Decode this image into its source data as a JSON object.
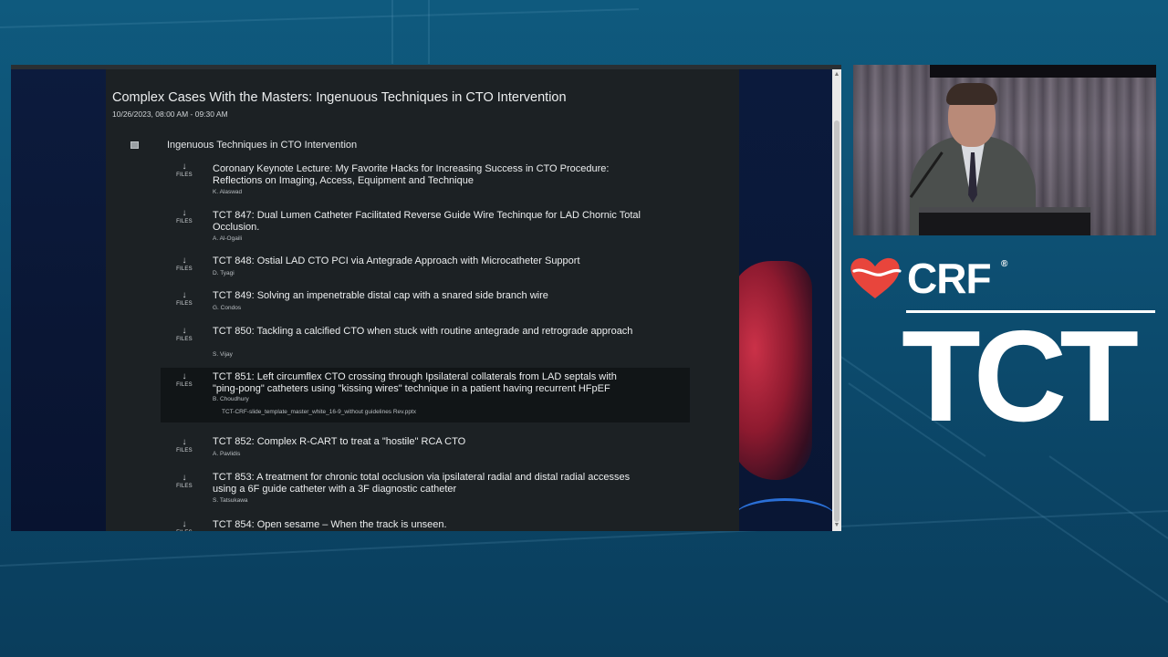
{
  "session": {
    "title": "Complex Cases With the Masters: Ingenuous Techniques in CTO Intervention",
    "datetime": "10/26/2023, 08:00 AM - 09:30 AM",
    "group_title": "Ingenuous Techniques in CTO Intervention"
  },
  "files_label": "FILES",
  "download_glyph": "↓",
  "items": [
    {
      "title": "Coronary Keynote Lecture: My Favorite Hacks for Increasing Success in CTO Procedure: Reflections on Imaging, Access, Equipment and Technique",
      "author": "K. Alaswad"
    },
    {
      "title": "TCT 847: Dual Lumen Catheter Facilitated Reverse Guide Wire Techinque for LAD Chornic Total Occlusion.",
      "author": "A. Al-Ogaili"
    },
    {
      "title": "TCT 848: Ostial LAD CTO PCI via Antegrade Approach with Microcatheter Support",
      "author": "D. Tyagi"
    },
    {
      "title": "TCT 849: Solving an impenetrable distal cap with a snared side branch wire",
      "author": "G. Condos"
    },
    {
      "title": "TCT 850: Tackling a calcified CTO when stuck with routine antegrade and retrograde approach",
      "author": "S. Vijay"
    },
    {
      "title": "TCT 851: Left circumflex CTO crossing through Ipsilateral collaterals from LAD septals with \"ping-pong\" catheters using \"kissing wires\" technique in a patient having recurrent HFpEF",
      "author": "B. Choudhury",
      "attachment": "TCT-CRF-slide_template_master_white_16-9_without guidelines Rev.pptx"
    },
    {
      "title": "TCT 852: Complex R-CART to treat a \"hostile\" RCA CTO",
      "author": "A. Pavlidis"
    },
    {
      "title": "TCT 853: A treatment for chronic total occlusion via ipsilateral radial and distal radial accesses using a 6F guide catheter with a 3F diagnostic catheter",
      "author": "S. Tatsukawa"
    },
    {
      "title": "TCT 854: Open sesame – When the track is unseen.",
      "author": ""
    }
  ],
  "branding": {
    "crf": "CRF",
    "registered": "®",
    "tct": "TCT",
    "heart_color": "#e8453c"
  },
  "scroll": {
    "up_glyph": "▲",
    "down_glyph": "▼"
  }
}
